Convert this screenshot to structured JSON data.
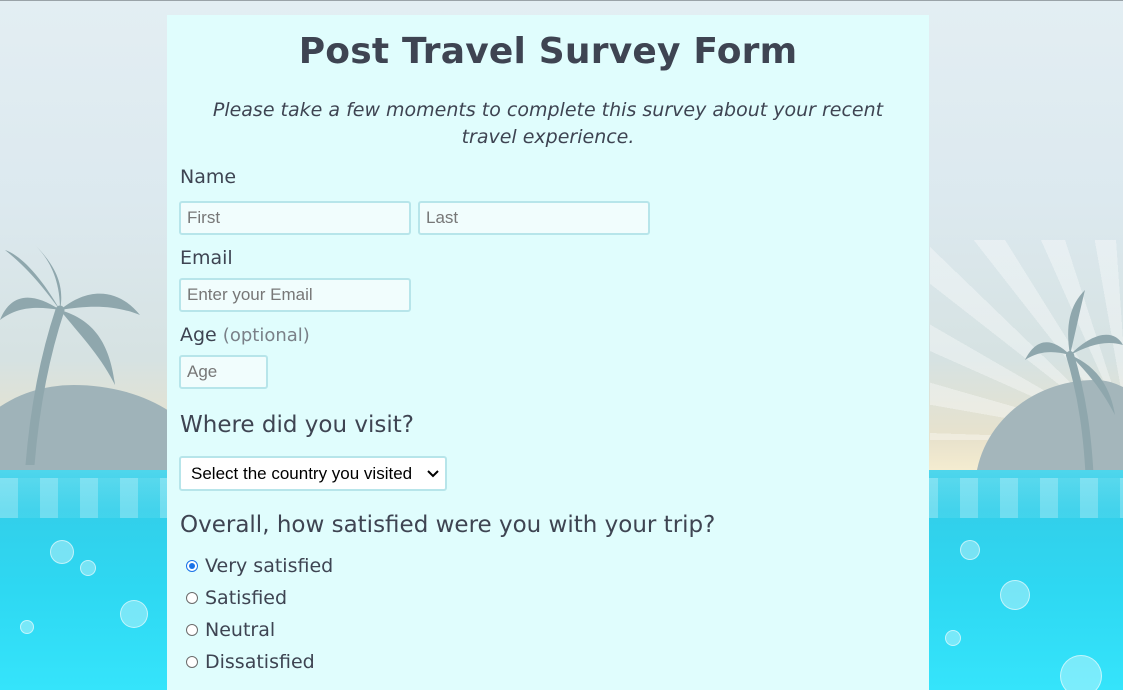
{
  "form": {
    "title": "Post Travel Survey Form",
    "description": "Please take a few moments to complete this survey about your recent travel experience.",
    "name_label": "Name",
    "first_placeholder": "First",
    "last_placeholder": "Last",
    "email_label": "Email",
    "email_placeholder": "Enter your Email",
    "age_label": "Age",
    "age_optional": "(optional)",
    "age_placeholder": "Age",
    "visit_heading": "Where did you visit?",
    "country_select_value": "Select the country you visited",
    "satisfaction_heading": "Overall, how satisfied were you with your trip?",
    "satisfaction_options": [
      {
        "label": "Very satisfied",
        "checked": true
      },
      {
        "label": "Satisfied",
        "checked": false
      },
      {
        "label": "Neutral",
        "checked": false
      },
      {
        "label": "Dissatisfied",
        "checked": false
      }
    ]
  },
  "colors": {
    "panel_background": "#e0fdfd",
    "text": "#3e4452",
    "input_border": "#b7e5ea",
    "radio_accent": "#1a73e8",
    "sea": "#2ed8f2"
  },
  "icons": {
    "select_arrow": "chevron-down-icon",
    "background_palms": "palm-tree-icon"
  }
}
